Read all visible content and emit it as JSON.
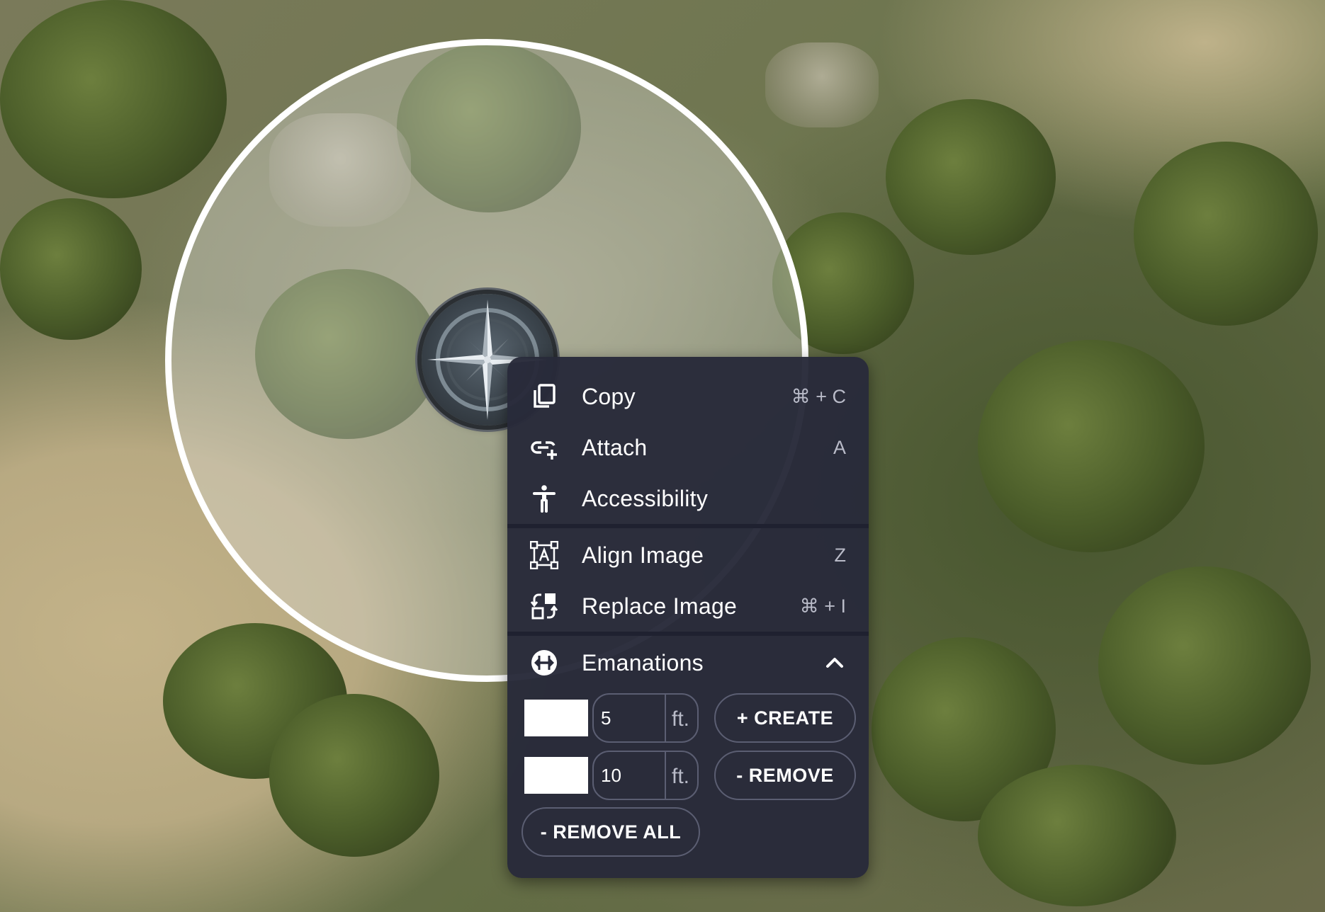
{
  "context_menu": {
    "items": [
      {
        "label": "Copy",
        "shortcut": "⌘ + C",
        "icon": "copy-icon"
      },
      {
        "label": "Attach",
        "shortcut": "A",
        "icon": "attach-icon"
      },
      {
        "label": "Accessibility",
        "shortcut": "",
        "icon": "accessibility-icon"
      },
      {
        "label": "Align Image",
        "shortcut": "Z",
        "icon": "align-image-icon"
      },
      {
        "label": "Replace Image",
        "shortcut": "⌘ + I",
        "icon": "replace-image-icon"
      }
    ],
    "emanations": {
      "label": "Emanations",
      "icon": "emanations-icon",
      "expanded": true,
      "rows": [
        {
          "color": "#ffffff",
          "value": "5",
          "unit": "ft."
        },
        {
          "color": "#ffffff",
          "value": "10",
          "unit": "ft."
        }
      ],
      "create_label": "+ CREATE",
      "remove_label": "- REMOVE",
      "remove_all_label": "- REMOVE ALL"
    }
  },
  "token": {
    "icon": "compass-rose-icon"
  },
  "aura": {
    "color": "#ffffff"
  },
  "colors": {
    "menu_background": "#282a3a",
    "menu_text": "#ffffff",
    "shortcut_text": "#b9bbc8",
    "border": "#5b5e72"
  }
}
